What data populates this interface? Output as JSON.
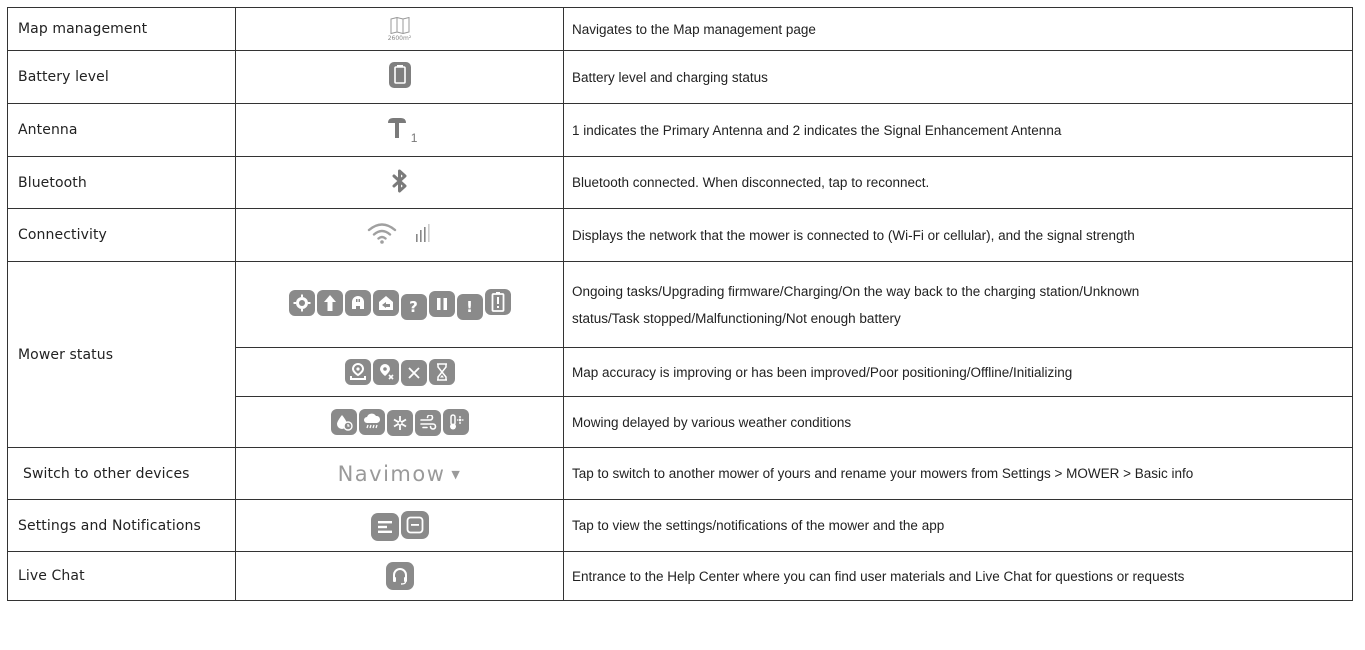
{
  "rows": [
    {
      "label": "Map management",
      "desc": "Navigates to the Map management page",
      "icon_caption": "2600m²",
      "icons": [
        "map-icon"
      ]
    },
    {
      "label": "Battery level",
      "desc": "Battery level and charging status",
      "icons": [
        "battery-icon"
      ]
    },
    {
      "label": "Antenna",
      "desc": "1 indicates the Primary Antenna and 2 indicates the Signal Enhancement Antenna",
      "icon_caption": "1",
      "icons": [
        "antenna-icon"
      ]
    },
    {
      "label": "Bluetooth",
      "desc": "Bluetooth connected. When disconnected, tap to reconnect.",
      "icons": [
        "bluetooth-icon"
      ]
    },
    {
      "label": "Connectivity",
      "desc": "Displays the network that the mower is connected to (Wi-Fi or cellular), and the signal strength",
      "icons": [
        "wifi-icon",
        "cellular-signal-icon"
      ]
    },
    {
      "label": "Mower status",
      "sub": [
        {
          "desc_line1": "Ongoing tasks/Upgrading firmware/Charging/On the way back to the charging station/Unknown",
          "desc_line2": "status/Task stopped/Malfunctioning/Not enough battery",
          "icons": [
            "ongoing-task-icon",
            "upgrade-icon",
            "charging-icon",
            "returning-icon",
            "unknown-icon",
            "task-stopped-icon",
            "malfunction-icon",
            "low-battery-icon"
          ],
          "glyphs": {
            "unknown": "?",
            "malfunction": "!"
          }
        },
        {
          "desc": "Map accuracy is improving or has been improved/Poor positioning/Offline/Initializing",
          "icons": [
            "map-accuracy-icon",
            "poor-positioning-icon",
            "offline-icon",
            "initializing-icon"
          ]
        },
        {
          "desc": "Mowing delayed by various weather conditions",
          "icons": [
            "rain-delay-icon",
            "storm-icon",
            "frost-icon",
            "wind-icon",
            "heat-icon"
          ]
        }
      ]
    },
    {
      "label": "Switch to other devices",
      "desc": "Tap to switch to another mower of yours and rename your mowers from Settings > MOWER > Basic info",
      "device_name": "Navimow",
      "caret": "▼"
    },
    {
      "label": "Settings and Notifications",
      "desc": "Tap to view the settings/notifications of the mower and the app",
      "icons": [
        "settings-icon",
        "notifications-icon"
      ]
    },
    {
      "label": "Live Chat",
      "desc": "Entrance to the Help Center where you can find user materials and Live Chat for questions or requests",
      "icons": [
        "live-chat-icon"
      ]
    }
  ],
  "colors": {
    "border": "#333333",
    "icon_gray": "#8a8a8a",
    "text": "#222222"
  }
}
